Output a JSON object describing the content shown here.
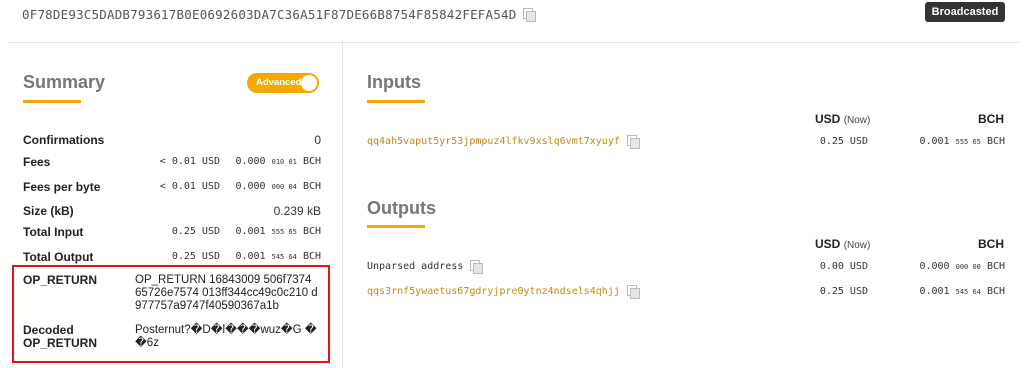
{
  "header": {
    "tx_hash": "0F78DE93C5DADB793617B0E0692603DA7C36A51F87DE66B8754F85842FEFA54D",
    "status": "Broadcasted"
  },
  "summary": {
    "title": "Summary",
    "toggle_label": "Advanced",
    "rows": {
      "confirmations": {
        "label": "Confirmations",
        "value": "0"
      },
      "fees": {
        "label": "Fees",
        "usd": "< 0.01 USD",
        "bch_main": "0.000",
        "bch_small": "010 01",
        "bch_unit": "BCH"
      },
      "fees_per_byte": {
        "label": "Fees per byte",
        "usd": "< 0.01 USD",
        "bch_main": "0.000",
        "bch_small": "000 04",
        "bch_unit": "BCH"
      },
      "size": {
        "label": "Size (kB)",
        "value": "0.239 kB"
      },
      "total_input": {
        "label": "Total Input",
        "usd": "0.25 USD",
        "bch_main": "0.001",
        "bch_small": "555 65",
        "bch_unit": "BCH"
      },
      "total_output": {
        "label": "Total Output",
        "usd": "0.25 USD",
        "bch_main": "0.001",
        "bch_small": "545 64",
        "bch_unit": "BCH"
      }
    },
    "op_return": {
      "label": "OP_RETURN",
      "value": "OP_RETURN 16843009 506f7374 65726e7574 013ff344cc49c0c210 d977757a9747f40590367a1b",
      "decoded_label_1": "Decoded",
      "decoded_label_2": "OP_RETURN",
      "decoded_value": "Posternut?�D�l���wuz�G ��6z"
    }
  },
  "inputs": {
    "title": "Inputs",
    "usd_header": "USD",
    "usd_now": "(Now)",
    "bch_header": "BCH",
    "items": [
      {
        "address": "qq4ah5vaput5yr53jpmpuz4lfkv9xslq6vmt7xyuyf",
        "usd": "0.25 USD",
        "bch_main": "0.001",
        "bch_small": "555 65",
        "bch_unit": "BCH"
      }
    ]
  },
  "outputs": {
    "title": "Outputs",
    "usd_header": "USD",
    "usd_now": "(Now)",
    "bch_header": "BCH",
    "items": [
      {
        "address": "Unparsed address",
        "usd": "0.00 USD",
        "bch_main": "0.000",
        "bch_small": "000 00",
        "bch_unit": "BCH"
      },
      {
        "address": "qqs3rnf5ywaetus67gdryjpre0ytnz4ndsels4qhjj",
        "usd": "0.25 USD",
        "bch_main": "0.001",
        "bch_small": "545 64",
        "bch_unit": "BCH"
      }
    ]
  },
  "icons": {
    "copy": "copy-icon"
  },
  "colors": {
    "accent": "#f5a800",
    "address": "#c8890b",
    "badge": "#333333",
    "highlight_box": "#e01515"
  }
}
